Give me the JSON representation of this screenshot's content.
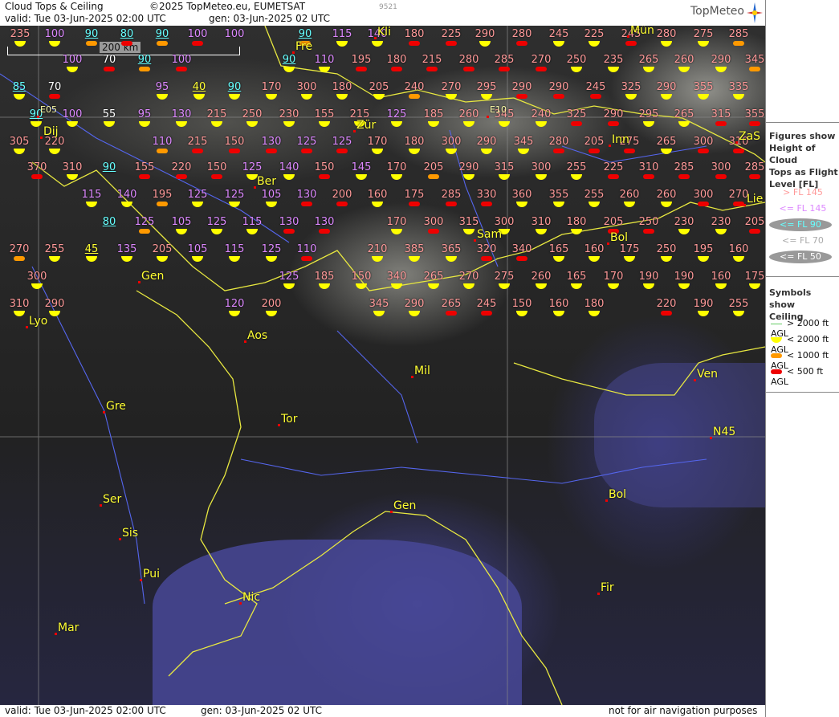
{
  "header": {
    "title": "Cloud Tops & Ceiling",
    "copyright": "©2025 TopMeteo.eu, EUMETSAT",
    "valid": "valid:  Tue  03-Jun-2025  02:00 UTC",
    "gen": "gen: 03-Jun-2025 02 UTC",
    "image_number": "9521",
    "logo": "TopMeteo"
  },
  "scale": {
    "label": "200 km"
  },
  "colors": {
    "gt145": "#ff9999",
    "le145": "#dd88ff",
    "le90": "#66ffff",
    "le70": "#ffffff",
    "le50": "#ffff33"
  },
  "sidebar": {
    "figures_heading": [
      "Figures show",
      "Height of Cloud",
      "Tops as Flight",
      "Level  [FL]"
    ],
    "levels": [
      {
        "label": "> FL 145",
        "color": "#ff9999",
        "style": "plain"
      },
      {
        "label": "<= FL 145",
        "color": "#dd88ff",
        "style": "plain"
      },
      {
        "label": "<= FL 90",
        "color": "#66ffff",
        "style": "ellipse"
      },
      {
        "label": "<= FL 70",
        "color": "#dddddd",
        "style": "plain"
      },
      {
        "label": "<= FL 50",
        "color": "#ffffff",
        "style": "ellipse"
      }
    ],
    "symbols_heading": [
      "Symbols show",
      "Ceiling"
    ],
    "symbols": [
      {
        "label": "> 2000 ft AGL",
        "symbol": "line"
      },
      {
        "label": "< 2000 ft AGL",
        "symbol": "yellow"
      },
      {
        "label": "< 1000 ft AGL",
        "symbol": "orange"
      },
      {
        "label": "< 500 ft AGL",
        "symbol": "red"
      }
    ]
  },
  "footer": {
    "valid": "valid:  Tue  03-Jun-2025  02:00 UTC",
    "gen": "gen: 03-Jun-2025 02 UTC",
    "note": "not for air navigation purposes"
  },
  "cities": [
    "Fre",
    "Kli",
    "Mün",
    "Dij",
    "Zür",
    "Inn",
    "ZaS",
    "Ber",
    "Lie",
    "Sam",
    "Bol",
    "Gen",
    "Lyo",
    "Aos",
    "Mil",
    "Ven",
    "Gre",
    "Tor",
    "N45",
    "Ser",
    "Sis",
    "Gen",
    "Bol",
    "Pui",
    "Nic",
    "Fir",
    "Mar",
    "E05",
    "E10"
  ],
  "stations": [
    {
      "v": "235",
      "c": "gt145",
      "s": "yellow"
    },
    {
      "v": "100",
      "c": "le145",
      "s": "yellow"
    },
    {
      "v": "90",
      "c": "le90",
      "s": "orange"
    },
    {
      "v": "80",
      "c": "le90",
      "s": "red"
    },
    {
      "v": "90",
      "c": "le90",
      "s": "orange"
    },
    {
      "v": "100",
      "c": "le145",
      "s": "red"
    },
    {
      "v": "100",
      "c": "le145",
      "s": ""
    },
    {
      "v": "90",
      "c": "le90",
      "s": "orange"
    },
    {
      "v": "115",
      "c": "le145",
      "s": "yellow"
    },
    {
      "v": "140",
      "c": "le145",
      "s": "yellow"
    },
    {
      "v": "180",
      "c": "gt145",
      "s": "red"
    },
    {
      "v": "225",
      "c": "gt145",
      "s": "red"
    },
    {
      "v": "290",
      "c": "gt145",
      "s": "yellow"
    },
    {
      "v": "280",
      "c": "gt145",
      "s": "red"
    },
    {
      "v": "245",
      "c": "gt145",
      "s": "yellow"
    },
    {
      "v": "225",
      "c": "gt145",
      "s": "yellow"
    },
    {
      "v": "245",
      "c": "gt145",
      "s": "red"
    },
    {
      "v": "280",
      "c": "gt145",
      "s": "yellow"
    },
    {
      "v": "275",
      "c": "gt145",
      "s": "yellow"
    },
    {
      "v": "285",
      "c": "gt145",
      "s": "orange"
    },
    {
      "v": "100",
      "c": "le145",
      "s": "yellow"
    },
    {
      "v": "70",
      "c": "le70",
      "s": "red"
    },
    {
      "v": "90",
      "c": "le90",
      "s": "orange"
    },
    {
      "v": "100",
      "c": "le145",
      "s": "red"
    },
    {
      "v": "90",
      "c": "le90",
      "s": "yellow"
    },
    {
      "v": "110",
      "c": "le145",
      "s": "yellow"
    },
    {
      "v": "195",
      "c": "gt145",
      "s": "red"
    },
    {
      "v": "180",
      "c": "gt145",
      "s": "red"
    },
    {
      "v": "215",
      "c": "gt145",
      "s": "red"
    },
    {
      "v": "280",
      "c": "gt145",
      "s": "red"
    },
    {
      "v": "285",
      "c": "gt145",
      "s": "red"
    },
    {
      "v": "270",
      "c": "gt145",
      "s": "red"
    },
    {
      "v": "250",
      "c": "gt145",
      "s": "yellow"
    },
    {
      "v": "235",
      "c": "gt145",
      "s": "yellow"
    },
    {
      "v": "265",
      "c": "gt145",
      "s": "yellow"
    },
    {
      "v": "260",
      "c": "gt145",
      "s": "yellow"
    },
    {
      "v": "290",
      "c": "gt145",
      "s": "yellow"
    },
    {
      "v": "345",
      "c": "gt145",
      "s": "orange"
    },
    {
      "v": "85",
      "c": "le90",
      "s": "yellow"
    },
    {
      "v": "70",
      "c": "le70",
      "s": "red"
    },
    {
      "v": "95",
      "c": "le145",
      "s": "yellow"
    },
    {
      "v": "40",
      "c": "le50",
      "s": "yellow"
    },
    {
      "v": "90",
      "c": "le90",
      "s": "yellow"
    },
    {
      "v": "170",
      "c": "gt145",
      "s": "yellow"
    },
    {
      "v": "300",
      "c": "gt145",
      "s": "yellow"
    },
    {
      "v": "180",
      "c": "gt145",
      "s": "yellow"
    },
    {
      "v": "205",
      "c": "gt145",
      "s": "yellow"
    },
    {
      "v": "240",
      "c": "gt145",
      "s": "orange"
    },
    {
      "v": "270",
      "c": "gt145",
      "s": "yellow"
    },
    {
      "v": "295",
      "c": "gt145",
      "s": "yellow"
    },
    {
      "v": "290",
      "c": "gt145",
      "s": "red"
    },
    {
      "v": "290",
      "c": "gt145",
      "s": "red"
    },
    {
      "v": "245",
      "c": "gt145",
      "s": "red"
    },
    {
      "v": "325",
      "c": "gt145",
      "s": "yellow"
    },
    {
      "v": "290",
      "c": "gt145",
      "s": "yellow"
    },
    {
      "v": "355",
      "c": "gt145",
      "s": "yellow"
    },
    {
      "v": "335",
      "c": "gt145",
      "s": "yellow"
    },
    {
      "v": "90",
      "c": "le90",
      "s": "yellow"
    },
    {
      "v": "100",
      "c": "le145",
      "s": "yellow"
    },
    {
      "v": "55",
      "c": "le70",
      "s": "yellow"
    },
    {
      "v": "95",
      "c": "le145",
      "s": "yellow"
    },
    {
      "v": "130",
      "c": "le145",
      "s": "yellow"
    },
    {
      "v": "215",
      "c": "gt145",
      "s": "yellow"
    },
    {
      "v": "250",
      "c": "gt145",
      "s": "yellow"
    },
    {
      "v": "230",
      "c": "gt145",
      "s": "yellow"
    },
    {
      "v": "155",
      "c": "gt145",
      "s": "yellow"
    },
    {
      "v": "215",
      "c": "gt145",
      "s": "yellow"
    },
    {
      "v": "125",
      "c": "le145",
      "s": "yellow"
    },
    {
      "v": "185",
      "c": "gt145",
      "s": "yellow"
    },
    {
      "v": "260",
      "c": "gt145",
      "s": "yellow"
    },
    {
      "v": "345",
      "c": "gt145",
      "s": "yellow"
    },
    {
      "v": "240",
      "c": "gt145",
      "s": "yellow"
    },
    {
      "v": "325",
      "c": "gt145",
      "s": "red"
    },
    {
      "v": "290",
      "c": "gt145",
      "s": "red"
    },
    {
      "v": "295",
      "c": "gt145",
      "s": "yellow"
    },
    {
      "v": "265",
      "c": "gt145",
      "s": "yellow"
    },
    {
      "v": "315",
      "c": "gt145",
      "s": "red"
    },
    {
      "v": "355",
      "c": "gt145",
      "s": "red"
    },
    {
      "v": "305",
      "c": "gt145",
      "s": "yellow"
    },
    {
      "v": "220",
      "c": "gt145",
      "s": "yellow"
    },
    {
      "v": "110",
      "c": "le145",
      "s": "orange"
    },
    {
      "v": "215",
      "c": "gt145",
      "s": "red"
    },
    {
      "v": "150",
      "c": "gt145",
      "s": "red"
    },
    {
      "v": "130",
      "c": "le145",
      "s": "red"
    },
    {
      "v": "125",
      "c": "le145",
      "s": "red"
    },
    {
      "v": "125",
      "c": "le145",
      "s": "red"
    },
    {
      "v": "170",
      "c": "gt145",
      "s": "yellow"
    },
    {
      "v": "180",
      "c": "gt145",
      "s": "yellow"
    },
    {
      "v": "300",
      "c": "gt145",
      "s": "yellow"
    },
    {
      "v": "290",
      "c": "gt145",
      "s": "yellow"
    },
    {
      "v": "345",
      "c": "gt145",
      "s": "yellow"
    },
    {
      "v": "280",
      "c": "gt145",
      "s": "red"
    },
    {
      "v": "205",
      "c": "gt145",
      "s": "red"
    },
    {
      "v": "275",
      "c": "gt145",
      "s": "red"
    },
    {
      "v": "265",
      "c": "gt145",
      "s": "yellow"
    },
    {
      "v": "300",
      "c": "gt145",
      "s": "red"
    },
    {
      "v": "310",
      "c": "gt145",
      "s": "red"
    },
    {
      "v": "370",
      "c": "gt145",
      "s": "red"
    },
    {
      "v": "310",
      "c": "gt145",
      "s": "yellow"
    },
    {
      "v": "90",
      "c": "le90",
      "s": ""
    },
    {
      "v": "155",
      "c": "gt145",
      "s": "red"
    },
    {
      "v": "220",
      "c": "gt145",
      "s": "red"
    },
    {
      "v": "150",
      "c": "gt145",
      "s": "red"
    },
    {
      "v": "125",
      "c": "le145",
      "s": "yellow"
    },
    {
      "v": "140",
      "c": "le145",
      "s": "yellow"
    },
    {
      "v": "150",
      "c": "gt145",
      "s": "red"
    },
    {
      "v": "145",
      "c": "le145",
      "s": "yellow"
    },
    {
      "v": "170",
      "c": "gt145",
      "s": "yellow"
    },
    {
      "v": "205",
      "c": "gt145",
      "s": "orange"
    },
    {
      "v": "290",
      "c": "gt145",
      "s": "yellow"
    },
    {
      "v": "315",
      "c": "gt145",
      "s": "yellow"
    },
    {
      "v": "300",
      "c": "gt145",
      "s": "yellow"
    },
    {
      "v": "255",
      "c": "gt145",
      "s": "yellow"
    },
    {
      "v": "225",
      "c": "gt145",
      "s": "red"
    },
    {
      "v": "310",
      "c": "gt145",
      "s": "red"
    },
    {
      "v": "285",
      "c": "gt145",
      "s": "red"
    },
    {
      "v": "300",
      "c": "gt145",
      "s": "red"
    },
    {
      "v": "285",
      "c": "gt145",
      "s": "red"
    },
    {
      "v": "115",
      "c": "le145",
      "s": "yellow"
    },
    {
      "v": "140",
      "c": "le145",
      "s": "yellow"
    },
    {
      "v": "195",
      "c": "gt145",
      "s": "orange"
    },
    {
      "v": "125",
      "c": "le145",
      "s": "yellow"
    },
    {
      "v": "125",
      "c": "le145",
      "s": "yellow"
    },
    {
      "v": "105",
      "c": "le145",
      "s": "yellow"
    },
    {
      "v": "130",
      "c": "le145",
      "s": "red"
    },
    {
      "v": "200",
      "c": "gt145",
      "s": "red"
    },
    {
      "v": "160",
      "c": "gt145",
      "s": "yellow"
    },
    {
      "v": "175",
      "c": "gt145",
      "s": "red"
    },
    {
      "v": "285",
      "c": "gt145",
      "s": "red"
    },
    {
      "v": "330",
      "c": "gt145",
      "s": "red"
    },
    {
      "v": "360",
      "c": "gt145",
      "s": "yellow"
    },
    {
      "v": "355",
      "c": "gt145",
      "s": "yellow"
    },
    {
      "v": "255",
      "c": "gt145",
      "s": "yellow"
    },
    {
      "v": "260",
      "c": "gt145",
      "s": "yellow"
    },
    {
      "v": "260",
      "c": "gt145",
      "s": "yellow"
    },
    {
      "v": "300",
      "c": "gt145",
      "s": "red"
    },
    {
      "v": "270",
      "c": "gt145",
      "s": "red"
    },
    {
      "v": "80",
      "c": "le90",
      "s": ""
    },
    {
      "v": "125",
      "c": "le145",
      "s": "orange"
    },
    {
      "v": "105",
      "c": "le145",
      "s": "yellow"
    },
    {
      "v": "125",
      "c": "le145",
      "s": "yellow"
    },
    {
      "v": "115",
      "c": "le145",
      "s": "yellow"
    },
    {
      "v": "130",
      "c": "le145",
      "s": "red"
    },
    {
      "v": "130",
      "c": "le145",
      "s": "red"
    },
    {
      "v": "170",
      "c": "gt145",
      "s": "yellow"
    },
    {
      "v": "300",
      "c": "gt145",
      "s": "red"
    },
    {
      "v": "315",
      "c": "gt145",
      "s": "yellow"
    },
    {
      "v": "300",
      "c": "gt145",
      "s": "yellow"
    },
    {
      "v": "310",
      "c": "gt145",
      "s": "yellow"
    },
    {
      "v": "180",
      "c": "gt145",
      "s": "yellow"
    },
    {
      "v": "205",
      "c": "gt145",
      "s": "red"
    },
    {
      "v": "250",
      "c": "gt145",
      "s": "red"
    },
    {
      "v": "230",
      "c": "gt145",
      "s": "yellow"
    },
    {
      "v": "230",
      "c": "gt145",
      "s": "yellow"
    },
    {
      "v": "205",
      "c": "gt145",
      "s": "red"
    },
    {
      "v": "270",
      "c": "gt145",
      "s": "orange"
    },
    {
      "v": "255",
      "c": "gt145",
      "s": "yellow"
    },
    {
      "v": "45",
      "c": "le50",
      "s": "yellow"
    },
    {
      "v": "135",
      "c": "le145",
      "s": "yellow"
    },
    {
      "v": "205",
      "c": "gt145",
      "s": "yellow"
    },
    {
      "v": "105",
      "c": "le145",
      "s": "yellow"
    },
    {
      "v": "115",
      "c": "le145",
      "s": "yellow"
    },
    {
      "v": "125",
      "c": "le145",
      "s": "yellow"
    },
    {
      "v": "110",
      "c": "le145",
      "s": "red"
    },
    {
      "v": "210",
      "c": "gt145",
      "s": "yellow"
    },
    {
      "v": "385",
      "c": "gt145",
      "s": "yellow"
    },
    {
      "v": "365",
      "c": "gt145",
      "s": "yellow"
    },
    {
      "v": "320",
      "c": "gt145",
      "s": "red"
    },
    {
      "v": "340",
      "c": "gt145",
      "s": "red"
    },
    {
      "v": "165",
      "c": "gt145",
      "s": "yellow"
    },
    {
      "v": "160",
      "c": "gt145",
      "s": "yellow"
    },
    {
      "v": "175",
      "c": "gt145",
      "s": "yellow"
    },
    {
      "v": "250",
      "c": "gt145",
      "s": "yellow"
    },
    {
      "v": "195",
      "c": "gt145",
      "s": "yellow"
    },
    {
      "v": "160",
      "c": "gt145",
      "s": "yellow"
    },
    {
      "v": "300",
      "c": "gt145",
      "s": "yellow"
    },
    {
      "v": "125",
      "c": "le145",
      "s": "yellow"
    },
    {
      "v": "185",
      "c": "gt145",
      "s": "yellow"
    },
    {
      "v": "150",
      "c": "gt145",
      "s": "yellow"
    },
    {
      "v": "340",
      "c": "gt145",
      "s": "yellow"
    },
    {
      "v": "265",
      "c": "gt145",
      "s": "yellow"
    },
    {
      "v": "270",
      "c": "gt145",
      "s": "yellow"
    },
    {
      "v": "275",
      "c": "gt145",
      "s": "yellow"
    },
    {
      "v": "260",
      "c": "gt145",
      "s": "yellow"
    },
    {
      "v": "165",
      "c": "gt145",
      "s": "yellow"
    },
    {
      "v": "170",
      "c": "gt145",
      "s": "yellow"
    },
    {
      "v": "190",
      "c": "gt145",
      "s": "yellow"
    },
    {
      "v": "190",
      "c": "gt145",
      "s": "yellow"
    },
    {
      "v": "160",
      "c": "gt145",
      "s": "yellow"
    },
    {
      "v": "175",
      "c": "gt145",
      "s": "yellow"
    },
    {
      "v": "310",
      "c": "gt145",
      "s": "yellow"
    },
    {
      "v": "290",
      "c": "gt145",
      "s": "yellow"
    },
    {
      "v": "120",
      "c": "le145",
      "s": "yellow"
    },
    {
      "v": "200",
      "c": "gt145",
      "s": "yellow"
    },
    {
      "v": "345",
      "c": "gt145",
      "s": "yellow"
    },
    {
      "v": "290",
      "c": "gt145",
      "s": "yellow"
    },
    {
      "v": "265",
      "c": "gt145",
      "s": "red"
    },
    {
      "v": "245",
      "c": "gt145",
      "s": "red"
    },
    {
      "v": "150",
      "c": "gt145",
      "s": "yellow"
    },
    {
      "v": "160",
      "c": "gt145",
      "s": "yellow"
    },
    {
      "v": "180",
      "c": "gt145",
      "s": "yellow"
    },
    {
      "v": "220",
      "c": "gt145",
      "s": "red"
    },
    {
      "v": "190",
      "c": "gt145",
      "s": "yellow"
    },
    {
      "v": "255",
      "c": "gt145",
      "s": "yellow"
    }
  ]
}
